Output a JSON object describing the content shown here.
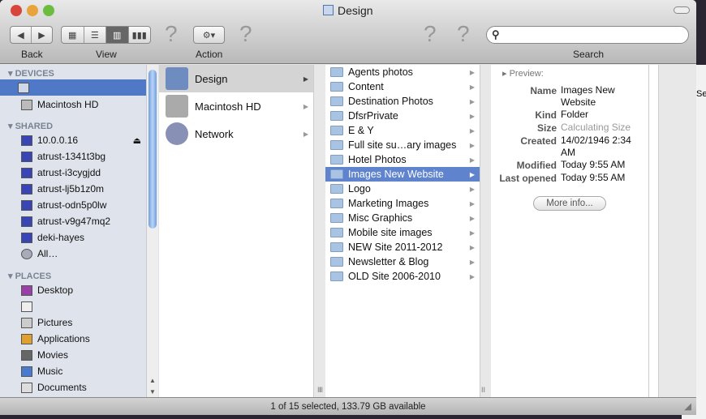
{
  "window": {
    "title": "Design"
  },
  "toolbar": {
    "back_label": "Back",
    "view_label": "View",
    "action_label": "Action",
    "search_label": "Search",
    "search_value": ""
  },
  "sidebar": {
    "devices_header": "DEVICES",
    "devices": [
      "",
      "Macintosh HD"
    ],
    "shared_header": "SHARED",
    "shared": [
      "10.0.0.16",
      "atrust-1341t3bg",
      "atrust-i3cygjdd",
      "atrust-lj5b1z0m",
      "atrust-odn5p0lw",
      "atrust-v9g47mq2",
      "deki-hayes",
      "All…"
    ],
    "places_header": "PLACES",
    "places": [
      "Desktop",
      "",
      "Pictures",
      "Applications",
      "Movies",
      "Music",
      "Documents"
    ]
  },
  "column1": [
    "Design",
    "Macintosh HD",
    "Network"
  ],
  "column2": [
    "Agents photos",
    "Content",
    "Destination Photos",
    "DfsrPrivate",
    "E & Y",
    "Full site su…ary images",
    "Hotel Photos",
    "Images New Website",
    "Logo",
    "Marketing Images",
    "Misc Graphics",
    "Mobile site images",
    "NEW Site 2011-2012",
    "Newsletter & Blog",
    "OLD Site 2006-2010"
  ],
  "preview": {
    "label": "Preview:",
    "name_k": "Name",
    "name_v": "Images New Website",
    "kind_k": "Kind",
    "kind_v": "Folder",
    "size_k": "Size",
    "size_v": "Calculating Size",
    "created_k": "Created",
    "created_v": "14/02/1946 2:34 AM",
    "modified_k": "Modified",
    "modified_v": "Today 9:55 AM",
    "opened_k": "Last opened",
    "opened_v": "Today 9:55 AM",
    "more_info": "More info..."
  },
  "status": "1 of 15 selected, 133.79 GB available",
  "background": {
    "partial_text": "Se"
  }
}
